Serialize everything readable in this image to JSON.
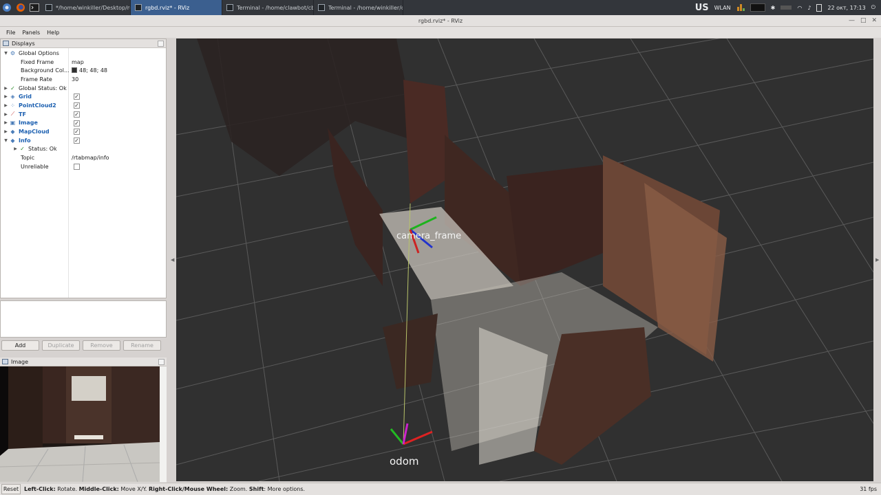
{
  "taskbar": {
    "tasks": [
      {
        "label": "*/home/winkiller/Desktop/ru...",
        "active": false
      },
      {
        "label": "rgbd.rviz* - RViz",
        "active": true
      },
      {
        "label": "Terminal - /home/clawbot/cb...",
        "active": false
      },
      {
        "label": "Terminal - /home/winkiller/c...",
        "active": false
      }
    ],
    "keyboard_layout": "us",
    "network": "WLAN",
    "datetime": "22 окт, 17:13"
  },
  "window": {
    "title": "rgbd.rviz* - RViz"
  },
  "menu": {
    "file": "File",
    "panels": "Panels",
    "help": "Help"
  },
  "displays_panel": {
    "title": "Displays",
    "global_options": "Global Options",
    "fixed_frame_label": "Fixed Frame",
    "fixed_frame_value": "map",
    "background_label": "Background Col...",
    "background_value": "48; 48; 48",
    "frame_rate_label": "Frame Rate",
    "frame_rate_value": "30",
    "global_status": "Global Status: Ok",
    "grid": "Grid",
    "pointcloud2": "PointCloud2",
    "tf": "TF",
    "image": "Image",
    "mapcloud": "MapCloud",
    "info": "Info",
    "status_ok": "Status: Ok",
    "topic_label": "Topic",
    "topic_value": "/rtabmap/info",
    "unreliable_label": "Unreliable"
  },
  "buttons": {
    "add": "Add",
    "duplicate": "Duplicate",
    "remove": "Remove",
    "rename": "Rename"
  },
  "image_panel": {
    "title": "Image"
  },
  "view": {
    "frame_label_top": "camera_frame",
    "frame_label_bottom": "odom"
  },
  "statusbar": {
    "reset": "Reset",
    "left_click": "Left-Click:",
    "left_click_text": " Rotate. ",
    "middle_click": "Middle-Click:",
    "middle_click_text": " Move X/Y. ",
    "right_click": "Right-Click/Mouse Wheel:",
    "right_click_text": " Zoom. ",
    "shift": "Shift",
    "shift_text": ": More options.",
    "fps": "31 fps"
  },
  "colors": {
    "view_background": "#303030",
    "accent": "#1b5fb0"
  }
}
